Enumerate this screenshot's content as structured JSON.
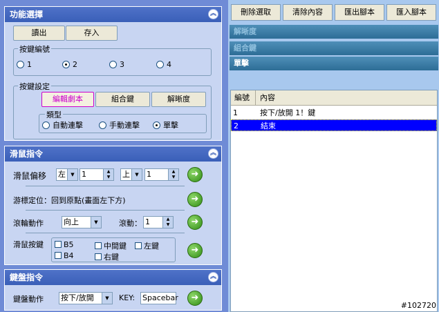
{
  "func_panel": {
    "title": "功能選擇",
    "read_label": "讀出",
    "save_label": "存入",
    "key_number": {
      "legend": "按鍵編號",
      "options": [
        "1",
        "2",
        "3",
        "4"
      ],
      "selected": "2"
    },
    "key_settings": {
      "legend": "按鍵設定",
      "tabs": [
        "編輯劇本",
        "組合鍵",
        "解晰度"
      ],
      "active_tab": "編輯劇本",
      "type_legend": "類型",
      "type_options": [
        "自動連擊",
        "手動連擊",
        "單擊"
      ],
      "type_selected": "單擊"
    }
  },
  "mouse_panel": {
    "title": "滑鼠指令",
    "offset_label": "滑鼠偏移",
    "offset_x_dir": "左",
    "offset_x_value": "1",
    "offset_y_dir": "上",
    "offset_y_value": "1",
    "cursor_label": "游標定位：回到原點(畫面左下方)",
    "wheel_label": "滾輪動作",
    "wheel_dir": "向上",
    "scroll_label": "滾動：",
    "scroll_value": "1",
    "buttons_label": "滑鼠按鍵",
    "button_options": [
      "B5",
      "中間鍵",
      "左鍵",
      "B4",
      "右鍵"
    ]
  },
  "keyboard_panel": {
    "title": "鍵盤指令",
    "action_label": "鍵盤動作",
    "action_value": "按下/放開",
    "key_label": "KEY:",
    "key_value": "Spacebar"
  },
  "toolbar": {
    "delete_label": "刪除選取",
    "clear_label": "清除內容",
    "export_label": "匯出腳本",
    "import_label": "匯入腳本"
  },
  "sections": [
    "解晰度",
    "組合鍵",
    "單擊"
  ],
  "script_table": {
    "headers": [
      "編號",
      "內容"
    ],
    "rows": [
      {
        "num": "1",
        "content": "按下/放開 1！鍵"
      },
      {
        "num": "2",
        "content": "結束"
      }
    ],
    "selected_row": 2
  },
  "watermark": "#102720",
  "colors": {
    "accent": "#3a5fb8",
    "selection": "#0000ff",
    "go_button": "#2f8b14"
  },
  "icons": [
    "collapse-chevrons-icon",
    "go-arrow-icon",
    "dropdown-arrow-icon",
    "spinner-icon"
  ]
}
